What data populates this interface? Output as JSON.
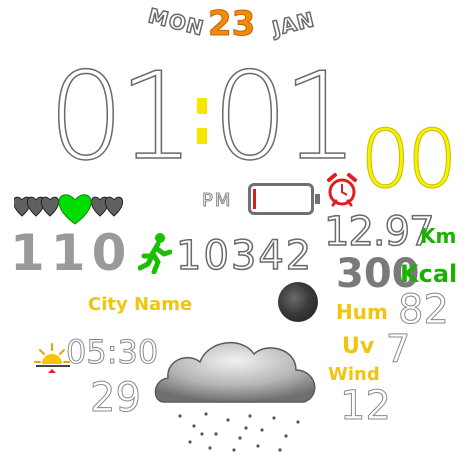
{
  "date": {
    "day_name": "MON",
    "day_number": "23",
    "month_name": "JAN"
  },
  "time": {
    "hours": "01",
    "minutes": "01",
    "seconds": "00",
    "ampm": "PM"
  },
  "battery": {
    "level_percent": 5,
    "fill_color": "#d32020"
  },
  "alarm": {
    "icon": "alarm-clock-icon"
  },
  "heart": {
    "icon": "heart-icon",
    "rate": "110",
    "accent": "#00dd00"
  },
  "activity": {
    "icon": "walking-person-icon",
    "steps": "10342"
  },
  "distance": {
    "value": "12.97",
    "unit": "Km"
  },
  "calories": {
    "value": "300",
    "unit": "Kcal"
  },
  "location": {
    "city": "City Name"
  },
  "moon": {
    "icon": "moon-phase-icon"
  },
  "weather": {
    "icon": "cloud-snow-icon",
    "humidity_label": "Hum",
    "humidity_value": "82",
    "uv_label": "Uv",
    "uv_value": "7",
    "wind_label": "Wind",
    "wind_value": "12",
    "sunrise_icon": "sunrise-icon",
    "sunrise_time": "05:30",
    "temperature": "29"
  },
  "colors": {
    "accent_yellow": "#f7f000",
    "accent_green": "#19b200",
    "accent_orange": "#f28a0a",
    "label_yellow": "#f1c40f"
  }
}
